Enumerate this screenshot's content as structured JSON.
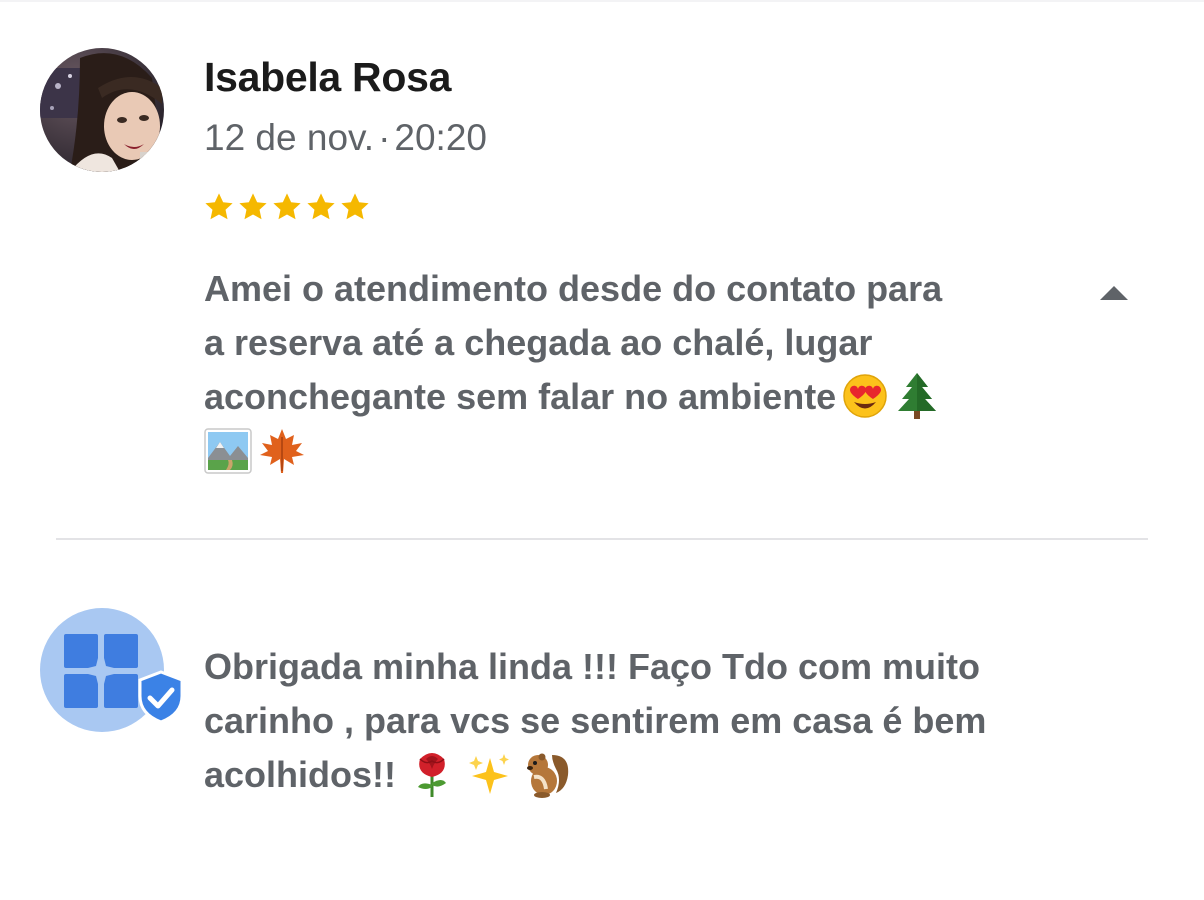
{
  "review": {
    "author": "Isabela Rosa",
    "date": "12 de nov.",
    "separator": "·",
    "time": "20:20",
    "rating": 5,
    "star_color": "#f5b800",
    "text_lines": [
      "Amei o atendimento desde do contato para",
      "a reserva até a chegada ao chalé, lugar",
      "aconchegante sem falar no ambiente"
    ],
    "emojis": [
      "heart-eyes-emoji",
      "evergreen-tree-emoji",
      "national-park-emoji",
      "maple-leaf-emoji"
    ],
    "toggle_icon": "caret-up-icon"
  },
  "owner_reply": {
    "avatar_color": "#a9c8f2",
    "logo_color": "#3f7de0",
    "verified_icon": "shield-check-icon",
    "text_lines": [
      "Obrigada minha linda !!! Faço Tdo com muito",
      "carinho , para vcs se sentirem em casa é bem",
      "acolhidos!!"
    ],
    "emojis": [
      "rose-emoji",
      "sparkles-emoji",
      "chipmunk-emoji"
    ]
  }
}
